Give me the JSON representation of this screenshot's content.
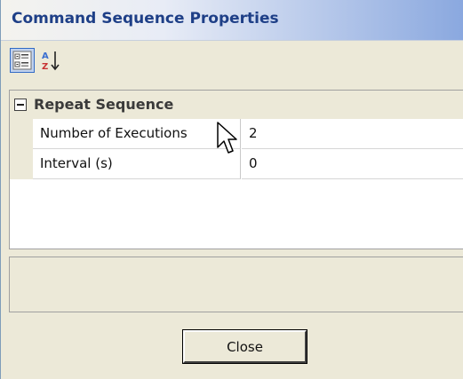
{
  "window": {
    "title": "Command Sequence Properties"
  },
  "toolbar": {
    "buttons": [
      {
        "icon": "categorized-icon",
        "state": "pressed"
      },
      {
        "icon": "sort-alphabetical-icon",
        "glyph_top": "A",
        "glyph_bottom": "Z"
      }
    ]
  },
  "property_grid": {
    "category": {
      "label": "Repeat Sequence",
      "expanded": true,
      "expander_symbol": "minus"
    },
    "properties": [
      {
        "name": "Number of Executions",
        "value": "2"
      },
      {
        "name": "Interval (s)",
        "value": "0"
      }
    ]
  },
  "footer": {
    "close_label": "Close"
  },
  "colors": {
    "title_text": "#1e3f87",
    "selected_button_fill": "#c1d2ee",
    "selected_button_border": "#316ac5",
    "panel_bg": "#ece9d8"
  },
  "cursor": {
    "icon": "mouse-pointer-icon"
  }
}
